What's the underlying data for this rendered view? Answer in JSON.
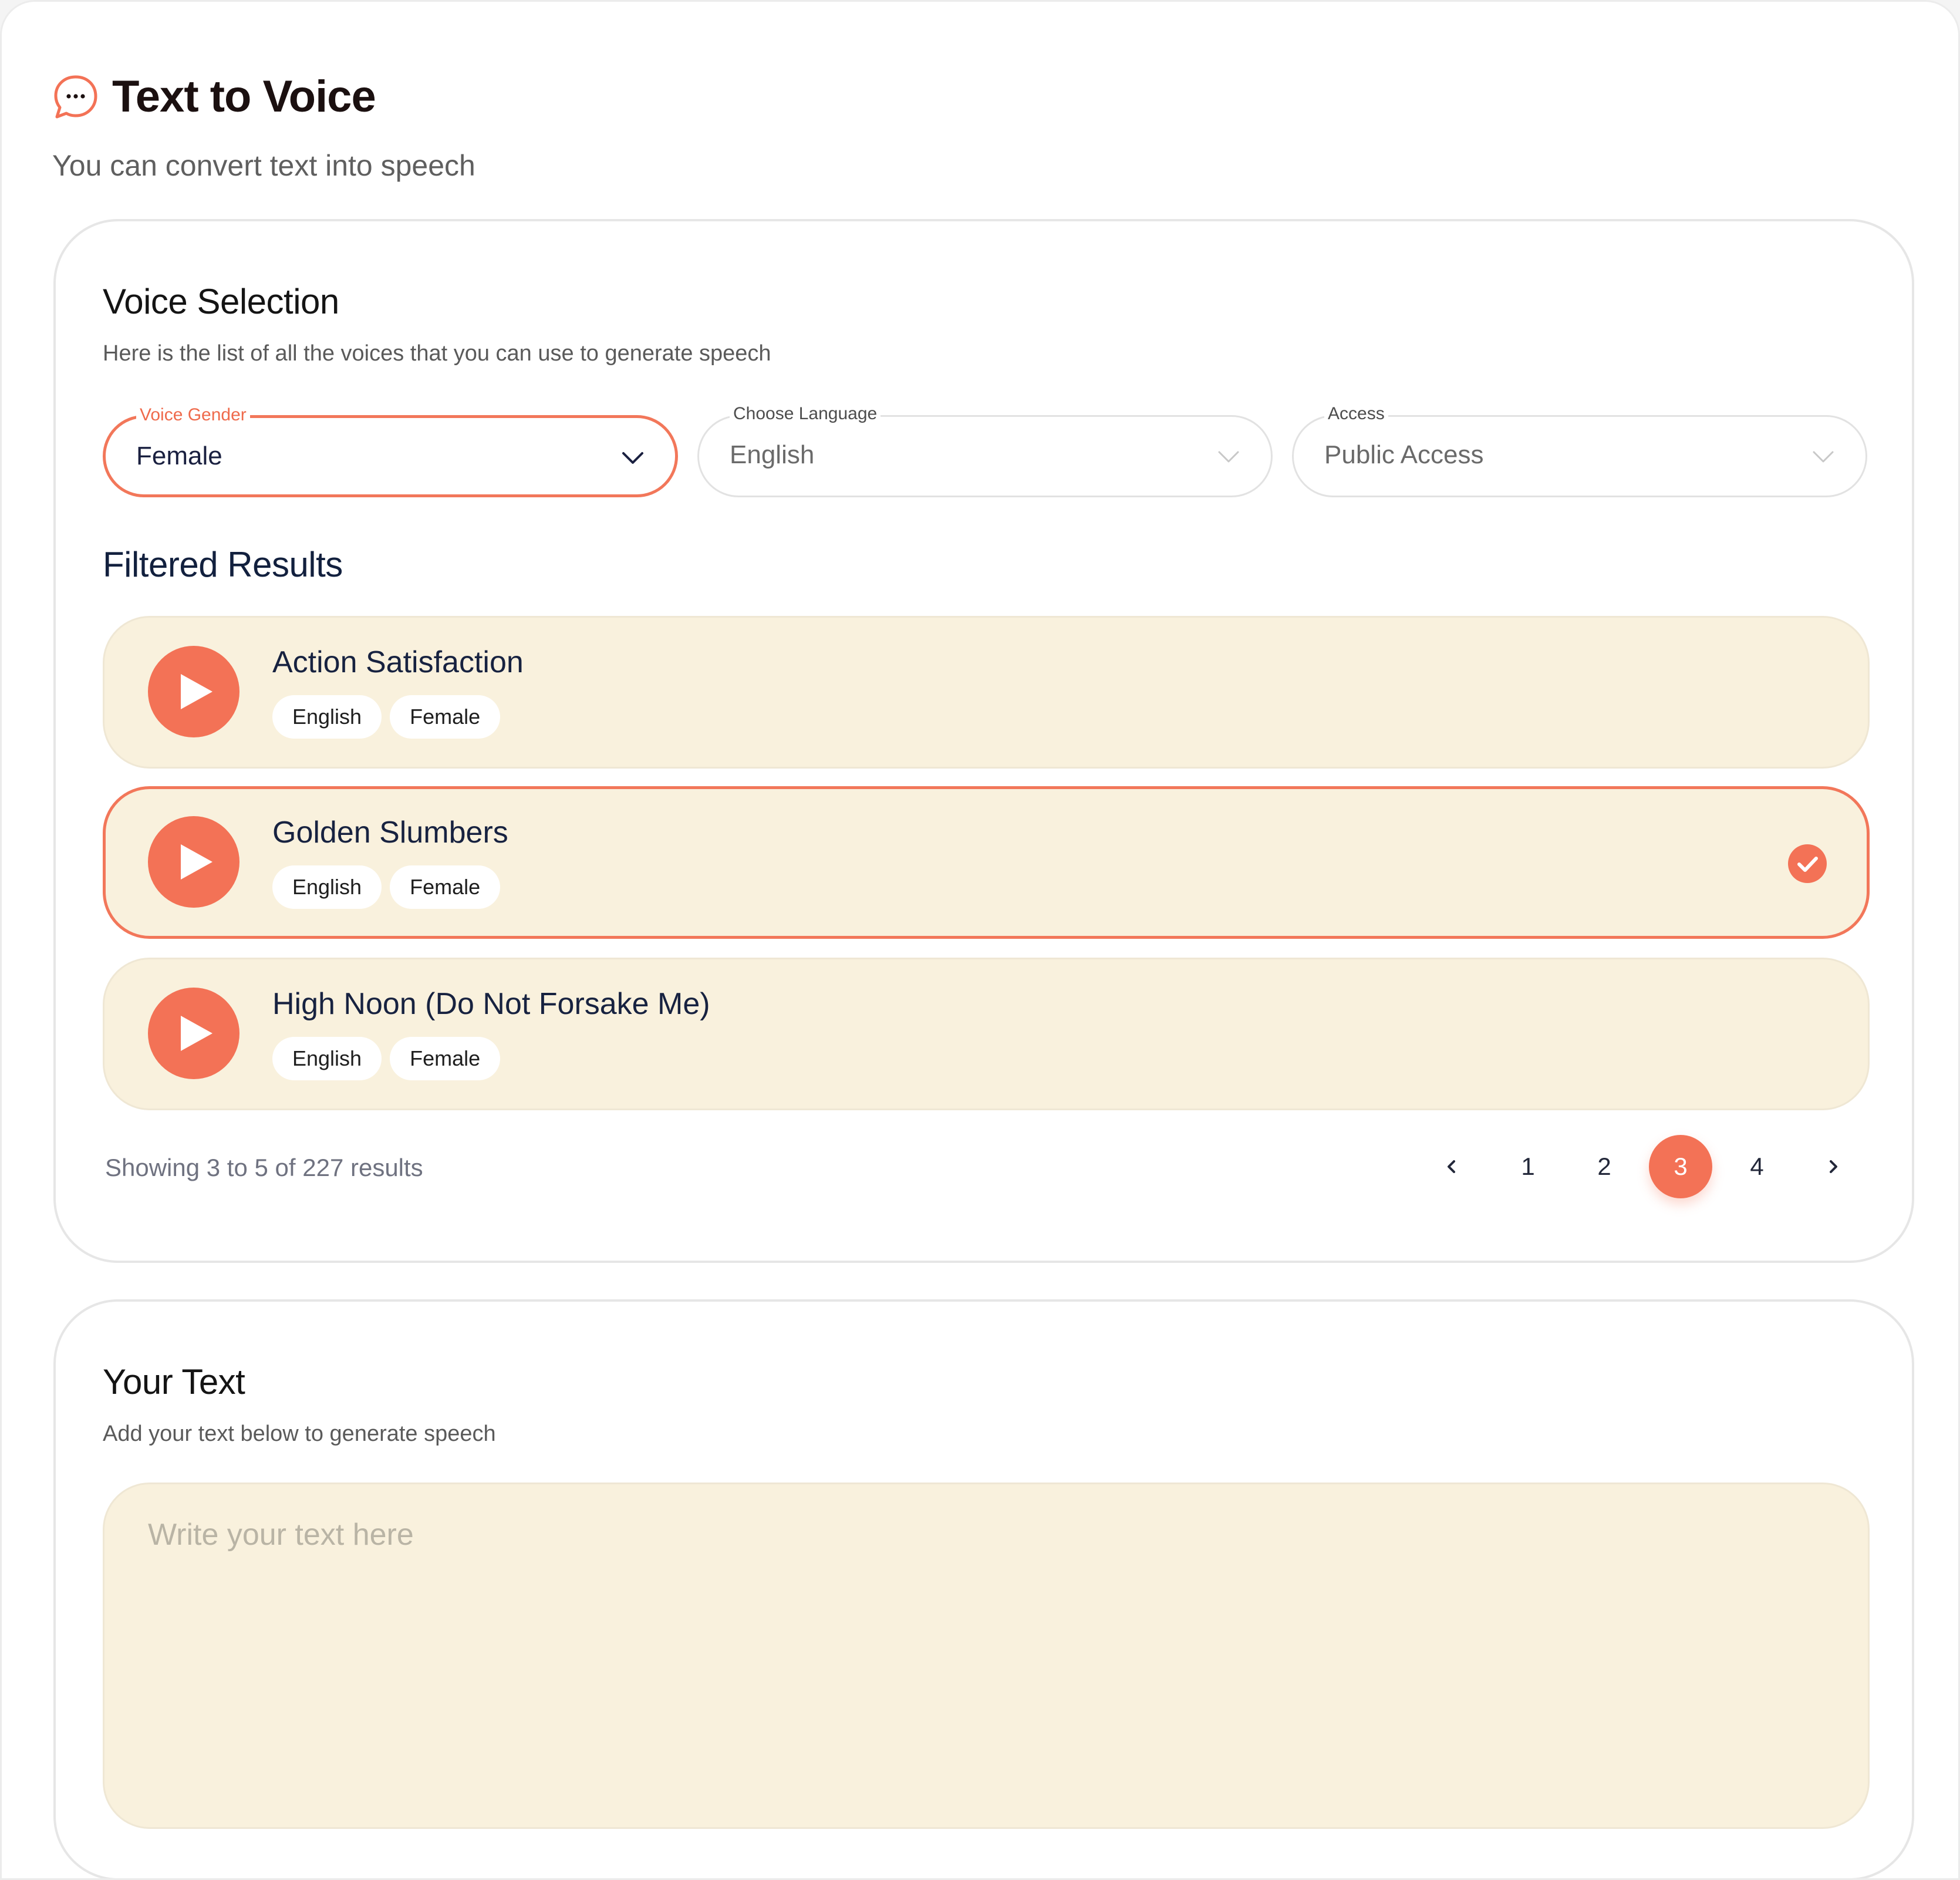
{
  "header": {
    "title": "Text to Voice",
    "subtitle": "You can convert text into speech",
    "icon": "chat-bubble-icon"
  },
  "voice_selection": {
    "title": "Voice Selection",
    "subtitle": "Here is the list of all the voices that you can use to generate speech",
    "filters": [
      {
        "label": "Voice Gender",
        "value": "Female"
      },
      {
        "label": "Choose Language",
        "value": "English"
      },
      {
        "label": "Access",
        "value": "Public Access"
      }
    ],
    "results_title": "Filtered Results",
    "voices": [
      {
        "name": "Action Satisfaction",
        "tags": [
          "English",
          "Female"
        ],
        "selected": false
      },
      {
        "name": "Golden Slumbers",
        "tags": [
          "English",
          "Female"
        ],
        "selected": true
      },
      {
        "name": "High Noon (Do Not Forsake Me)",
        "tags": [
          "English",
          "Female"
        ],
        "selected": false
      }
    ],
    "showing": "Showing 3 to 5 of 227 results",
    "pagination": {
      "pages": [
        "1",
        "2",
        "3",
        "4"
      ],
      "current": "3"
    }
  },
  "your_text": {
    "title": "Your Text",
    "subtitle": "Add your text below to generate speech",
    "placeholder": "Write your text here"
  },
  "colors": {
    "accent": "#f37256",
    "row_bg": "#f9f1dd",
    "title": "#12203e"
  }
}
